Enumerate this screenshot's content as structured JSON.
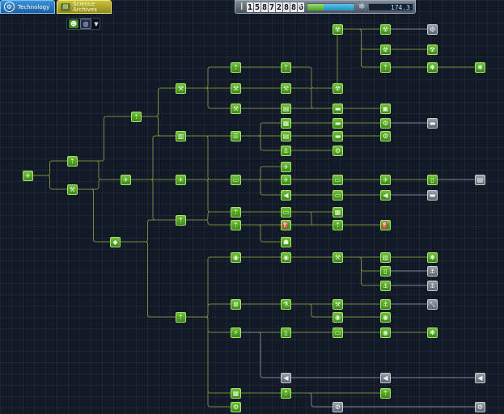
{
  "tabs": [
    {
      "label": "Technology",
      "icon": "gear-icon",
      "active": true
    },
    {
      "label": "Science Archives",
      "icon": "archive-icon",
      "active": false
    }
  ],
  "filters": [
    {
      "icon": "kerbal-icon"
    },
    {
      "icon": "globe-icon"
    },
    {
      "icon": "chevron-down-icon"
    }
  ],
  "resources": {
    "funds_digits": [
      "1",
      "5",
      "8",
      "7",
      "2",
      "8",
      "8",
      "6"
    ],
    "reputation_fraction": 0.35,
    "science": "174.3"
  },
  "colors": {
    "node_researched": "#4fa52a",
    "node_locked": "#7a8088",
    "line": "#6f8f3a",
    "background": "#121a28",
    "tab_technology": "#2a7bc4",
    "tab_archives": "#b5ae2c"
  }
}
